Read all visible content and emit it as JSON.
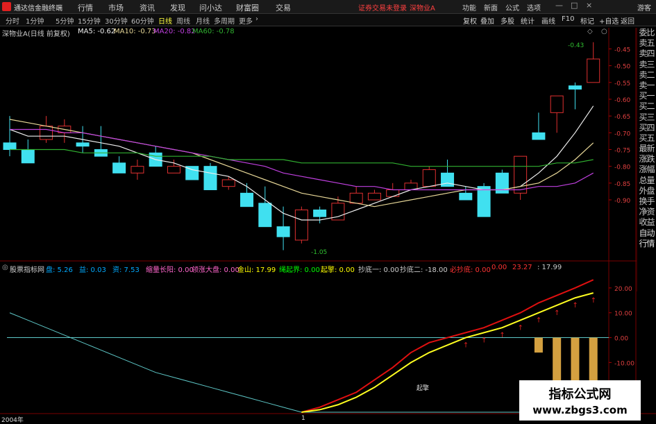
{
  "menubar": {
    "app_title": "通达信金融终端",
    "menus": [
      "行情",
      "市场",
      "资讯",
      "发现",
      "问小达",
      "财富圈",
      "交易"
    ],
    "status": "证券交易未登录",
    "stock": "深物业A",
    "right": [
      "功能",
      "新面",
      "公式",
      "选项"
    ],
    "user": "游客"
  },
  "periodbar": {
    "periods": [
      "分时",
      "1分钟",
      "5分钟",
      "15分钟",
      "30分钟",
      "60分钟",
      "日线",
      "周线",
      "月线",
      "多周期",
      "更多"
    ],
    "active": "日线",
    "tools": [
      "复权",
      "叠加",
      "多股",
      "统计",
      "画线",
      "F10",
      "标记",
      "+自选",
      "返回"
    ]
  },
  "main_legend": {
    "title": "深物业A(日线 前复权)",
    "ma5": "MA5: -0.62",
    "ma10": "MA10: -0.73",
    "ma20": "MA20: -0.82",
    "ma60": "MA60: -0.78"
  },
  "sub_legend": {
    "title": "股票指标网",
    "items": [
      {
        "t": "盘: 5.26",
        "c": "#0af"
      },
      {
        "t": "益: 0.03",
        "c": "#0af"
      },
      {
        "t": "资: 7.53",
        "c": "#0af"
      },
      {
        "t": "缩量长阳: 0.00",
        "c": "#f6c"
      },
      {
        "t": "领涨大盘: 0.00",
        "c": "#f6c"
      },
      {
        "t": "金山: 17.99",
        "c": "#ff0"
      },
      {
        "t": "绳起界: 0.00",
        "c": "#0f0"
      },
      {
        "t": "起擎: 0.00",
        "c": "#ff0"
      },
      {
        "t": "抄底一: 0.00",
        "c": "#ccc"
      },
      {
        "t": "抄底二: -18.00",
        "c": "#ccc"
      },
      {
        "t": "必抄底: 0.00",
        "c": "#f33"
      },
      {
        "t": "0.00",
        "c": "#f33"
      },
      {
        "t": "23.27",
        "c": "#f33"
      },
      {
        "t": ": 17.99",
        "c": "#ccc"
      }
    ]
  },
  "main_axis": [
    "-0.45",
    "-0.50",
    "-0.55",
    "-0.60",
    "-0.65",
    "-0.70",
    "-0.75",
    "-0.80",
    "-0.85",
    "-0.90"
  ],
  "sub_axis": [
    "20.00",
    "10.00",
    "0.00",
    "-10.00"
  ],
  "annotations": {
    "high": "-0.43",
    "low": "-1.05",
    "signal": "起擎"
  },
  "sidepanel": [
    "委比",
    "卖五",
    "卖四",
    "卖三",
    "卖二",
    "卖一",
    "买一",
    "买二",
    "买三",
    "买四",
    "买五",
    "最新",
    "涨跌",
    "涨幅",
    "总量",
    "外盘",
    "换手",
    "净资",
    "收益",
    "自动",
    "行情"
  ],
  "timeaxis": {
    "year": "2004年",
    "mark": "1"
  },
  "watermark": {
    "line1": "指标公式网",
    "line2": "www.zbgs3.com"
  },
  "chart_data": [
    {
      "type": "candlestick",
      "title": "深物业A(日线 前复权)",
      "ylim": [
        -1.08,
        -0.42
      ],
      "candles": [
        {
          "o": -0.73,
          "h": -0.65,
          "l": -0.77,
          "c": -0.75
        },
        {
          "o": -0.75,
          "h": -0.72,
          "l": -0.79,
          "c": -0.79
        },
        {
          "o": -0.72,
          "h": -0.65,
          "l": -0.73,
          "c": -0.68
        },
        {
          "o": -0.7,
          "h": -0.66,
          "l": -0.73,
          "c": -0.68
        },
        {
          "o": -0.73,
          "h": -0.68,
          "l": -0.76,
          "c": -0.74
        },
        {
          "o": -0.75,
          "h": -0.68,
          "l": -0.77,
          "c": -0.77
        },
        {
          "o": -0.79,
          "h": -0.77,
          "l": -0.82,
          "c": -0.82
        },
        {
          "o": -0.82,
          "h": -0.78,
          "l": -0.84,
          "c": -0.8
        },
        {
          "o": -0.76,
          "h": -0.74,
          "l": -0.8,
          "c": -0.8
        },
        {
          "o": -0.82,
          "h": -0.78,
          "l": -0.82,
          "c": -0.8
        },
        {
          "o": -0.8,
          "h": -0.8,
          "l": -0.84,
          "c": -0.84
        },
        {
          "o": -0.8,
          "h": -0.79,
          "l": -0.87,
          "c": -0.87
        },
        {
          "o": -0.86,
          "h": -0.83,
          "l": -0.87,
          "c": -0.84
        },
        {
          "o": -0.88,
          "h": -0.85,
          "l": -0.92,
          "c": -0.92
        },
        {
          "o": -0.91,
          "h": -0.86,
          "l": -0.98,
          "c": -0.98
        },
        {
          "o": -0.98,
          "h": -0.92,
          "l": -1.05,
          "c": -1.01
        },
        {
          "o": -1.02,
          "h": -0.92,
          "l": -1.03,
          "c": -0.93
        },
        {
          "o": -0.93,
          "h": -0.92,
          "l": -0.97,
          "c": -0.95
        },
        {
          "o": -0.96,
          "h": -0.89,
          "l": -0.96,
          "c": -0.91
        },
        {
          "o": -0.91,
          "h": -0.86,
          "l": -0.91,
          "c": -0.88
        },
        {
          "o": -0.9,
          "h": -0.87,
          "l": -0.9,
          "c": -0.88
        },
        {
          "o": -0.89,
          "h": -0.85,
          "l": -0.89,
          "c": -0.87
        },
        {
          "o": -0.87,
          "h": -0.84,
          "l": -0.87,
          "c": -0.85
        },
        {
          "o": -0.86,
          "h": -0.8,
          "l": -0.86,
          "c": -0.81
        },
        {
          "o": -0.82,
          "h": -0.78,
          "l": -0.86,
          "c": -0.86
        },
        {
          "o": -0.88,
          "h": -0.86,
          "l": -0.9,
          "c": -0.9
        },
        {
          "o": -0.86,
          "h": -0.85,
          "l": -0.95,
          "c": -0.95
        },
        {
          "o": -0.82,
          "h": -0.81,
          "l": -0.88,
          "c": -0.88
        },
        {
          "o": -0.88,
          "h": -0.77,
          "l": -0.9,
          "c": -0.77
        },
        {
          "o": -0.7,
          "h": -0.64,
          "l": -0.72,
          "c": -0.72
        },
        {
          "o": -0.64,
          "h": -0.61,
          "l": -0.7,
          "c": -0.59
        },
        {
          "o": -0.56,
          "h": -0.55,
          "l": -0.63,
          "c": -0.57
        },
        {
          "o": -0.55,
          "h": -0.43,
          "l": -0.55,
          "c": -0.48
        }
      ],
      "series": [
        {
          "name": "MA5",
          "color": "#eeeeee",
          "values": [
            -0.69,
            -0.71,
            -0.71,
            -0.71,
            -0.72,
            -0.73,
            -0.74,
            -0.76,
            -0.78,
            -0.79,
            -0.81,
            -0.82,
            -0.83,
            -0.86,
            -0.9,
            -0.94,
            -0.96,
            -0.96,
            -0.95,
            -0.93,
            -0.91,
            -0.89,
            -0.87,
            -0.86,
            -0.85,
            -0.86,
            -0.87,
            -0.87,
            -0.86,
            -0.82,
            -0.77,
            -0.7,
            -0.62
          ]
        },
        {
          "name": "MA10",
          "color": "#e8d898",
          "values": [
            -0.66,
            -0.67,
            -0.68,
            -0.69,
            -0.7,
            -0.71,
            -0.72,
            -0.73,
            -0.74,
            -0.75,
            -0.76,
            -0.78,
            -0.8,
            -0.82,
            -0.84,
            -0.86,
            -0.88,
            -0.89,
            -0.9,
            -0.91,
            -0.92,
            -0.91,
            -0.9,
            -0.89,
            -0.88,
            -0.87,
            -0.87,
            -0.87,
            -0.86,
            -0.85,
            -0.82,
            -0.78,
            -0.73
          ]
        },
        {
          "name": "MA20",
          "color": "#c040e0",
          "values": [
            -0.69,
            -0.69,
            -0.69,
            -0.7,
            -0.7,
            -0.71,
            -0.72,
            -0.73,
            -0.74,
            -0.75,
            -0.76,
            -0.77,
            -0.78,
            -0.79,
            -0.8,
            -0.82,
            -0.83,
            -0.84,
            -0.85,
            -0.86,
            -0.86,
            -0.87,
            -0.87,
            -0.87,
            -0.87,
            -0.87,
            -0.87,
            -0.87,
            -0.87,
            -0.86,
            -0.86,
            -0.85,
            -0.82
          ]
        },
        {
          "name": "MA60",
          "color": "#30b030",
          "values": [
            -0.75,
            -0.75,
            -0.75,
            -0.75,
            -0.76,
            -0.76,
            -0.76,
            -0.76,
            -0.77,
            -0.77,
            -0.77,
            -0.77,
            -0.78,
            -0.78,
            -0.78,
            -0.78,
            -0.79,
            -0.79,
            -0.79,
            -0.79,
            -0.79,
            -0.79,
            -0.8,
            -0.8,
            -0.8,
            -0.8,
            -0.8,
            -0.8,
            -0.8,
            -0.8,
            -0.79,
            -0.79,
            -0.78
          ]
        }
      ]
    },
    {
      "type": "line",
      "title": "股票指标网",
      "ylim": [
        -30,
        25
      ],
      "series": [
        {
          "name": "cyan",
          "color": "#5ec8c8",
          "values": [
            10,
            7,
            4,
            1,
            -2,
            -5,
            -8,
            -11,
            -14,
            -16,
            -18,
            -20,
            -22,
            -24,
            -26,
            -28,
            -30,
            -30,
            -30,
            -30,
            -30,
            -30,
            -30,
            -30,
            -30,
            -30,
            -30,
            -30,
            -30,
            -30,
            -30,
            -30,
            -30
          ]
        },
        {
          "name": "red",
          "color": "#e01010",
          "values": [
            null,
            null,
            null,
            null,
            null,
            null,
            null,
            null,
            null,
            null,
            null,
            null,
            null,
            null,
            null,
            null,
            -30,
            -28,
            -25,
            -22,
            -17,
            -12,
            -6,
            -2,
            0,
            2,
            4,
            7,
            10,
            14,
            17,
            20,
            23.27
          ]
        },
        {
          "name": "yellow",
          "color": "#ffff20",
          "values": [
            null,
            null,
            null,
            null,
            null,
            null,
            null,
            null,
            null,
            null,
            null,
            null,
            null,
            null,
            null,
            null,
            -30,
            -29,
            -27,
            -24,
            -20,
            -15,
            -10,
            -6,
            -3,
            0,
            2,
            4,
            7,
            10,
            13,
            16,
            17.99
          ]
        },
        {
          "name": "bars",
          "color": "#d4a040",
          "values": [
            0,
            0,
            0,
            0,
            0,
            0,
            0,
            0,
            0,
            0,
            0,
            0,
            0,
            0,
            0,
            0,
            0,
            0,
            0,
            0,
            0,
            0,
            0,
            0,
            0,
            0,
            0,
            0,
            0,
            -6,
            -18,
            -18,
            -18
          ]
        }
      ]
    }
  ]
}
